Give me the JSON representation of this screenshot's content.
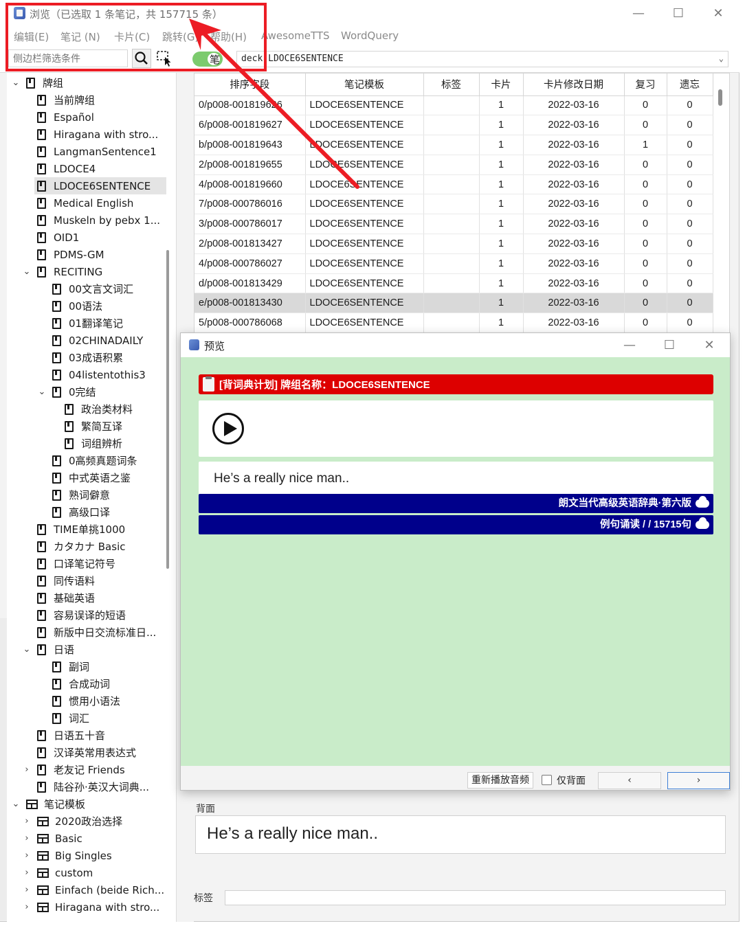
{
  "window": {
    "title": "浏览（已选取 1 条笔记，共 157715 条）",
    "min_glyph": "—",
    "max_glyph": "☐",
    "close_glyph": "✕"
  },
  "menu": [
    "编辑(E)",
    "笔记 (N)",
    "卡片(C)",
    "跳转(G)",
    "帮助(H)",
    "AwesomeTTS",
    "WordQuery"
  ],
  "toolbar": {
    "sidebar_filter_placeholder": "侧边栏筛选条件",
    "toggle_label": "笔",
    "search_query": "deck:LDOCE6SENTENCE"
  },
  "sidebar": {
    "rows": [
      {
        "label": "牌组",
        "indent": 0,
        "icon": "deck-icon",
        "chevron": "⌄"
      },
      {
        "label": "当前牌组",
        "indent": 1,
        "icon": "current-deck-icon"
      },
      {
        "label": "Español",
        "indent": 1,
        "icon": "deck-icon"
      },
      {
        "label": "Hiragana with stro...",
        "indent": 1,
        "icon": "deck-icon"
      },
      {
        "label": "LangmanSentence1",
        "indent": 1,
        "icon": "deck-icon"
      },
      {
        "label": "LDOCE4",
        "indent": 1,
        "icon": "deck-icon"
      },
      {
        "label": "LDOCE6SENTENCE",
        "indent": 1,
        "icon": "deck-icon",
        "selected": true
      },
      {
        "label": "Medical English",
        "indent": 1,
        "icon": "deck-icon"
      },
      {
        "label": "Muskeln by pebx 1...",
        "indent": 1,
        "icon": "deck-icon"
      },
      {
        "label": "OID1",
        "indent": 1,
        "icon": "deck-icon"
      },
      {
        "label": "PDMS-GM",
        "indent": 1,
        "icon": "deck-icon"
      },
      {
        "label": "RECITING",
        "indent": 1,
        "icon": "deck-icon",
        "chevron": "⌄"
      },
      {
        "label": "00文言文词汇",
        "indent": 2,
        "icon": "deck-icon"
      },
      {
        "label": "00语法",
        "indent": 2,
        "icon": "deck-icon"
      },
      {
        "label": "01翻译笔记",
        "indent": 2,
        "icon": "deck-icon"
      },
      {
        "label": "02CHINADAILY",
        "indent": 2,
        "icon": "deck-icon"
      },
      {
        "label": "03成语积累",
        "indent": 2,
        "icon": "deck-icon"
      },
      {
        "label": "04listentothis3",
        "indent": 2,
        "icon": "deck-icon"
      },
      {
        "label": "0完结",
        "indent": 2,
        "icon": "deck-icon",
        "chevron": "⌄"
      },
      {
        "label": "政治类材料",
        "indent": 3,
        "icon": "deck-icon"
      },
      {
        "label": "繁简互译",
        "indent": 3,
        "icon": "deck-icon"
      },
      {
        "label": "词组辨析",
        "indent": 3,
        "icon": "deck-icon"
      },
      {
        "label": "0高频真题词条",
        "indent": 2,
        "icon": "deck-icon"
      },
      {
        "label": "中式英语之鉴",
        "indent": 2,
        "icon": "deck-icon"
      },
      {
        "label": "熟词僻意",
        "indent": 2,
        "icon": "deck-icon"
      },
      {
        "label": "高级口译",
        "indent": 2,
        "icon": "deck-icon"
      },
      {
        "label": "TIME单挑1000",
        "indent": 1,
        "icon": "deck-icon"
      },
      {
        "label": "カタカナ Basic",
        "indent": 1,
        "icon": "deck-icon"
      },
      {
        "label": "口译笔记符号",
        "indent": 1,
        "icon": "deck-icon"
      },
      {
        "label": "同传语料",
        "indent": 1,
        "icon": "deck-icon"
      },
      {
        "label": "基础英语",
        "indent": 1,
        "icon": "deck-icon"
      },
      {
        "label": "容易误译的短语",
        "indent": 1,
        "icon": "deck-icon"
      },
      {
        "label": "新版中日交流标准日...",
        "indent": 1,
        "icon": "deck-icon"
      },
      {
        "label": "日语",
        "indent": 1,
        "icon": "deck-icon",
        "chevron": "⌄"
      },
      {
        "label": "副词",
        "indent": 2,
        "icon": "deck-icon"
      },
      {
        "label": "合成动词",
        "indent": 2,
        "icon": "deck-icon"
      },
      {
        "label": "惯用小语法",
        "indent": 2,
        "icon": "deck-icon"
      },
      {
        "label": "词汇",
        "indent": 2,
        "icon": "deck-icon"
      },
      {
        "label": "日语五十音",
        "indent": 1,
        "icon": "deck-icon"
      },
      {
        "label": "汉译英常用表达式",
        "indent": 1,
        "icon": "deck-icon"
      },
      {
        "label": "老友记 Friends",
        "indent": 1,
        "icon": "deck-icon",
        "chevron": "›"
      },
      {
        "label": "陆谷孙·英汉大词典...",
        "indent": 1,
        "icon": "deck-icon"
      },
      {
        "label": "笔记模板",
        "indent": 0,
        "icon": "model-icon",
        "chevron": "⌄"
      },
      {
        "label": "2020政治选择",
        "indent": 1,
        "icon": "model-icon",
        "chevron": "›"
      },
      {
        "label": "Basic",
        "indent": 1,
        "icon": "model-icon",
        "chevron": "›"
      },
      {
        "label": "Big Singles",
        "indent": 1,
        "icon": "model-icon",
        "chevron": "›"
      },
      {
        "label": "custom",
        "indent": 1,
        "icon": "model-icon",
        "chevron": "›"
      },
      {
        "label": "Einfach (beide Rich...",
        "indent": 1,
        "icon": "model-icon",
        "chevron": "›"
      },
      {
        "label": "Hiragana with stro...",
        "indent": 1,
        "icon": "model-icon",
        "chevron": "›"
      }
    ]
  },
  "table": {
    "columns": [
      "排序字段",
      "笔记模板",
      "标签",
      "卡片",
      "卡片修改日期",
      "复习",
      "遗忘"
    ],
    "rows": [
      [
        "0/p008-001819626",
        "LDOCE6SENTENCE",
        "",
        "1",
        "2022-03-16",
        "0",
        "0"
      ],
      [
        "6/p008-001819627",
        "LDOCE6SENTENCE",
        "",
        "1",
        "2022-03-16",
        "0",
        "0"
      ],
      [
        "b/p008-001819643",
        "LDOCE6SENTENCE",
        "",
        "1",
        "2022-03-16",
        "1",
        "0"
      ],
      [
        "2/p008-001819655",
        "LDOCE6SENTENCE",
        "",
        "1",
        "2022-03-16",
        "0",
        "0"
      ],
      [
        "4/p008-001819660",
        "LDOCE6SENTENCE",
        "",
        "1",
        "2022-03-16",
        "0",
        "0"
      ],
      [
        "7/p008-000786016",
        "LDOCE6SENTENCE",
        "",
        "1",
        "2022-03-16",
        "0",
        "0"
      ],
      [
        "3/p008-000786017",
        "LDOCE6SENTENCE",
        "",
        "1",
        "2022-03-16",
        "0",
        "0"
      ],
      [
        "2/p008-001813427",
        "LDOCE6SENTENCE",
        "",
        "1",
        "2022-03-16",
        "0",
        "0"
      ],
      [
        "4/p008-000786027",
        "LDOCE6SENTENCE",
        "",
        "1",
        "2022-03-16",
        "0",
        "0"
      ],
      [
        "d/p008-001813429",
        "LDOCE6SENTENCE",
        "",
        "1",
        "2022-03-16",
        "0",
        "0"
      ],
      [
        "e/p008-001813430",
        "LDOCE6SENTENCE",
        "",
        "1",
        "2022-03-16",
        "0",
        "0"
      ],
      [
        "5/p008-000786068",
        "LDOCE6SENTENCE",
        "",
        "1",
        "2022-03-16",
        "0",
        "0"
      ]
    ],
    "highlighted_row": 10
  },
  "editor": {
    "back_label": "背面",
    "back_value": "He’s a really nice man..",
    "tags_label": "标签"
  },
  "preview": {
    "title": "预览",
    "deck_banner": "[背词典计划] 牌组名称：LDOCE6SENTENCE",
    "sentence": "He’s a really nice man..",
    "source_bar": "朗文当代高级英语辞典·第六版",
    "count_bar": "例句诵读 / / 15715句",
    "replay_label": "重新播放音频",
    "back_only_label": "仅背面",
    "prev_glyph": "‹",
    "next_glyph": "›",
    "background_color": "#c9ecc9",
    "banner_color": "#dd0000",
    "bar_color": "#00008b"
  },
  "annotation": {
    "color": "#ec1c24"
  }
}
